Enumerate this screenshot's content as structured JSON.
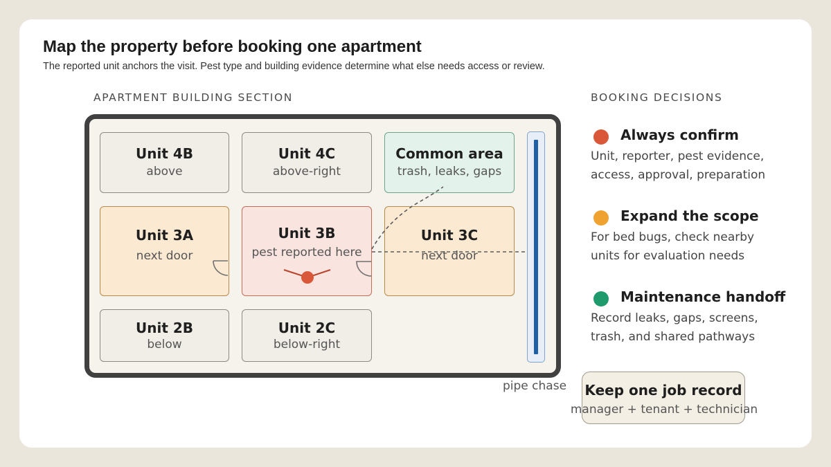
{
  "header": {
    "title": "Map the property before booking one apartment",
    "subtitle": "The reported unit anchors the visit. Pest type and building evidence determine what else needs access or review."
  },
  "building": {
    "section_label": "APARTMENT BUILDING SECTION",
    "units": {
      "u4b": {
        "name": "Unit 4B",
        "sub": "above"
      },
      "u4c": {
        "name": "Unit 4C",
        "sub": "above-right"
      },
      "common": {
        "name": "Common area",
        "sub": "trash, leaks, gaps"
      },
      "u3a": {
        "name": "Unit 3A",
        "sub": "next door"
      },
      "u3b": {
        "name": "Unit 3B",
        "sub": "pest reported here"
      },
      "u3c": {
        "name": "Unit 3C",
        "sub": "next door"
      },
      "u2b": {
        "name": "Unit 2B",
        "sub": "below"
      },
      "u2c": {
        "name": "Unit 2C",
        "sub": "below-right"
      }
    },
    "pipe_label": "pipe chase"
  },
  "decisions": {
    "section_label": "BOOKING DECISIONS",
    "confirm": {
      "heading": "Always confirm",
      "line1": "Unit, reporter, pest evidence,",
      "line2": "access, approval, preparation",
      "color": "#d9583a"
    },
    "expand": {
      "heading": "Expand the scope",
      "line1": "For bed bugs, check nearby",
      "line2": "units for evaluation needs",
      "color": "#efa22f"
    },
    "maintenance": {
      "heading": "Maintenance handoff",
      "line1": "Record leaks, gaps, screens,",
      "line2": "trash, and shared pathways",
      "color": "#1f9a6c"
    },
    "job_record": {
      "heading": "Keep one job record",
      "sub": "manager + tenant + technician"
    }
  },
  "colors": {
    "pest_marker": "#d9583a",
    "building_outline": "#3f403f",
    "pipe": "#1f5fa6"
  },
  "icons": {
    "pest_marker": "pest-marker-icon",
    "door_swing": "door-swing-icon"
  }
}
